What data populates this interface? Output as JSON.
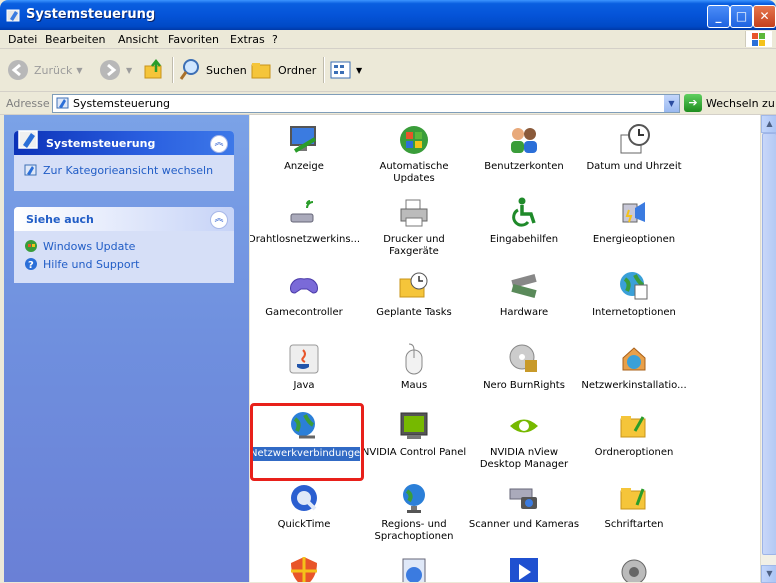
{
  "window": {
    "title": "Systemsteuerung",
    "min": "_",
    "max": "□",
    "close": "✕"
  },
  "menu": [
    "Datei",
    "Bearbeiten",
    "Ansicht",
    "Favoriten",
    "Extras",
    "?"
  ],
  "toolbar": {
    "back": "Zurück",
    "search": "Suchen",
    "folders": "Ordner"
  },
  "address": {
    "label": "Adresse",
    "value": "Systemsteuerung",
    "go": "Wechseln zu"
  },
  "task_panel": {
    "title": "Systemsteuerung",
    "items": [
      "Zur Kategorieansicht wechseln"
    ]
  },
  "see_also": {
    "title": "Siehe auch",
    "items": [
      "Windows Update",
      "Hilfe und Support"
    ]
  },
  "icons": [
    {
      "label": "Anzeige"
    },
    {
      "label": "Automatische Updates"
    },
    {
      "label": "Benutzerkonten"
    },
    {
      "label": "Datum und Uhrzeit"
    },
    {
      "label": "Drahtlosnetzwerkins..."
    },
    {
      "label": "Drucker und Faxgeräte"
    },
    {
      "label": "Eingabehilfen"
    },
    {
      "label": "Energieoptionen"
    },
    {
      "label": "Gamecontroller"
    },
    {
      "label": "Geplante Tasks"
    },
    {
      "label": "Hardware"
    },
    {
      "label": "Internetoptionen"
    },
    {
      "label": "Java"
    },
    {
      "label": "Maus"
    },
    {
      "label": "Nero BurnRights"
    },
    {
      "label": "Netzwerkinstallatio..."
    },
    {
      "label": "Netzwerkverbindungen"
    },
    {
      "label": "NVIDIA Control Panel"
    },
    {
      "label": "NVIDIA nView Desktop Manager"
    },
    {
      "label": "Ordneroptionen"
    },
    {
      "label": "QuickTime"
    },
    {
      "label": "Regions- und Sprachoptionen"
    },
    {
      "label": "Scanner und Kameras"
    },
    {
      "label": "Schriftarten"
    }
  ],
  "colors": {
    "selection": "#316ac5",
    "highlight_box": "#e8201a",
    "link": "#215dc6"
  }
}
